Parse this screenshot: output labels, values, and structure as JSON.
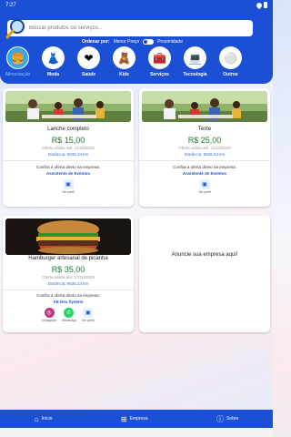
{
  "status": {
    "time": "7:27"
  },
  "search": {
    "placeholder": "Buscar produtos ou serviços..."
  },
  "sort": {
    "label": "Ordenar por:",
    "option1": "Menor Preço",
    "option2": "Proximidade"
  },
  "categories": [
    {
      "name": "Alimentação",
      "icon": "🍔"
    },
    {
      "name": "Moda",
      "icon": "👗"
    },
    {
      "name": "Saúde",
      "icon": "❤"
    },
    {
      "name": "Kids",
      "icon": "🧸"
    },
    {
      "name": "Serviços",
      "icon": "🧰"
    },
    {
      "name": "Tecnologia",
      "icon": "💻"
    },
    {
      "name": "Outros",
      "icon": "⚪"
    }
  ],
  "cards": [
    {
      "title": "Lanche completo",
      "price": "R$ 15,00",
      "valid": "Oferta válida até: 11/10/2025",
      "distance": "Distância: 9835.34 km",
      "offer_text": "Confira a oferta direto na empresa:",
      "company": "Assistente de Eventos",
      "contacts": [
        {
          "label": "Ver perfil",
          "icon": "profile-icon"
        }
      ]
    },
    {
      "title": "Teste",
      "price": "R$ 25,00",
      "valid": "Oferta válida até: 11/10/2025",
      "distance": "Distância: 9835.34 km",
      "offer_text": "Confira a oferta direto na empresa:",
      "company": "Assistente de Eventos",
      "contacts": [
        {
          "label": "Ver perfil",
          "icon": "profile-icon"
        }
      ]
    },
    {
      "title": "Hamburger artesanal de picanha",
      "price": "R$ 35,00",
      "valid": "Oferta válida até: 17/10/2025",
      "distance": "Distância: 9835.34 km",
      "offer_text": "Confira a oferta direto na empresa:",
      "company": "AE Dev System",
      "contacts": [
        {
          "label": "Instagram",
          "icon": "instagram-icon"
        },
        {
          "label": "WhatsApp",
          "icon": "whatsapp-icon"
        },
        {
          "label": "Ver perfil",
          "icon": "profile-icon"
        }
      ]
    }
  ],
  "ad": {
    "text": "Anuncie sua empresa aqui!"
  },
  "nav": {
    "home": "Início",
    "empresa": "Empresa",
    "sobre": "Sobre"
  }
}
